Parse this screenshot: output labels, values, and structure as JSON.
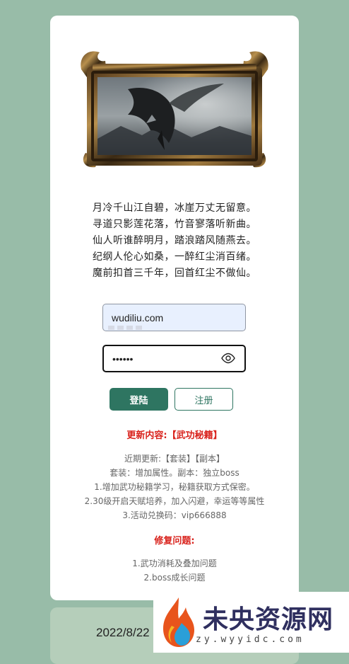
{
  "poem": [
    "月冷千山江自碧，冰崖万丈无留意。",
    "寻道只影莲花落，竹音寥落听新曲。",
    "仙人听谁醉明月，踏浪踏风随燕去。",
    "纪纲人伦心如桑，一醉红尘消百绪。",
    "魔前扣首三千年，回首红尘不做仙。"
  ],
  "login_form": {
    "username_value": "wudiliu.com",
    "password_value": "••••••",
    "login_label": "登陆",
    "register_label": "注册"
  },
  "update": {
    "title": "更新内容:【武功秘籍】",
    "lines": [
      "近期更新:【套装】【副本】",
      "套装：增加属性。副本：独立boss",
      "1.增加武功秘籍学习，秘籍获取方式保密。",
      "2.30级开启天赋培养，加入闪避，幸运等等属性",
      "3.活动兑换码：vip666888"
    ]
  },
  "fixes": {
    "title": "修复问题:",
    "lines": [
      "1.武功消耗及叠加问题",
      "2.boss成长问题"
    ]
  },
  "footer": {
    "date": "2022/8/22"
  },
  "watermark": {
    "title": "未央资源网",
    "url": "zy.wyyidc.com"
  },
  "colors": {
    "background": "#98bca8",
    "accent": "#2e7561",
    "alert": "#d9231d"
  },
  "icons": {
    "password_toggle": "eye-icon",
    "watermark_logo": "flame-logo"
  }
}
